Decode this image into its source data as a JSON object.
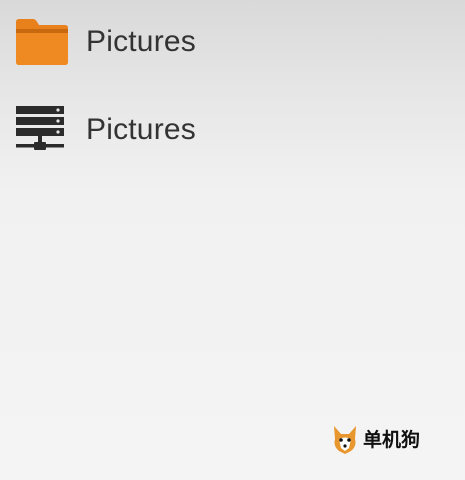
{
  "items": [
    {
      "label": "Pictures",
      "icon": "folder-icon",
      "icon_color": "#e8811c"
    },
    {
      "label": "Pictures",
      "icon": "network-server-icon",
      "icon_color": "#2b2b2b"
    }
  ],
  "watermark": {
    "text": "单机狗",
    "icon": "dog-logo-icon"
  }
}
